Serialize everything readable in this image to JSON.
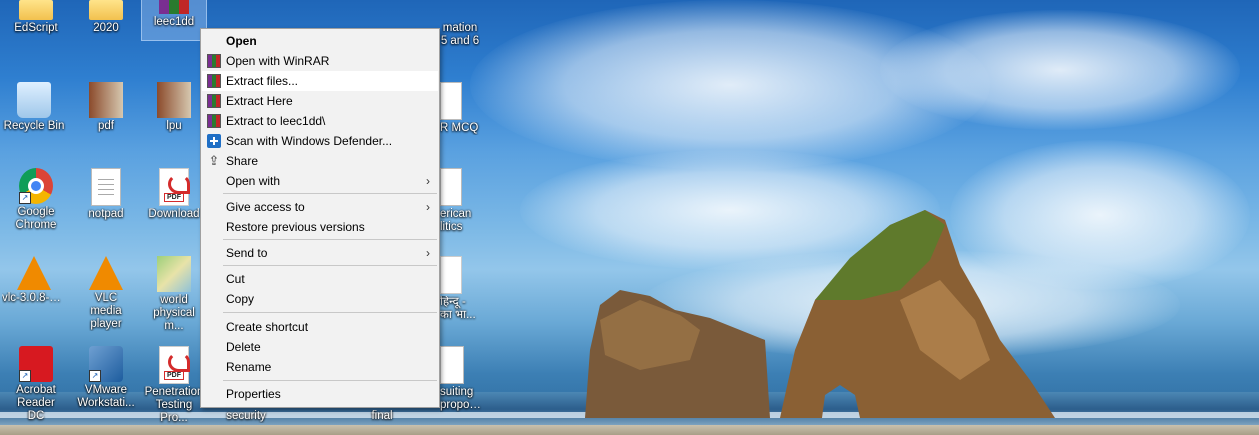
{
  "desktop": {
    "icons": [
      {
        "label": "EdScript",
        "kind": "folder"
      },
      {
        "label": "2020",
        "kind": "folder"
      },
      {
        "label": "leec1dd",
        "kind": "winrar-archive"
      },
      {
        "label": "Recycle Bin",
        "kind": "recycle-bin"
      },
      {
        "label": "pdf",
        "kind": "folder"
      },
      {
        "label": "lpu",
        "kind": "folder"
      },
      {
        "label": "Google Chrome",
        "kind": "chrome"
      },
      {
        "label": "notpad",
        "kind": "text-file"
      },
      {
        "label": "Download",
        "kind": "pdf"
      },
      {
        "label": "vlc-3.0.8-w...",
        "kind": "vlc"
      },
      {
        "label": "VLC media player",
        "kind": "vlc"
      },
      {
        "label": "world physical m...",
        "kind": "map"
      },
      {
        "label": "Acrobat Reader DC",
        "kind": "acrobat"
      },
      {
        "label": "VMware Workstati...",
        "kind": "vmware"
      },
      {
        "label": "Penetration Testing Pro...",
        "kind": "pdf"
      },
      {
        "label": "security",
        "kind": "file"
      },
      {
        "label": "final",
        "kind": "file"
      },
      {
        "label": "mation 5 and 6",
        "kind": "file"
      },
      {
        "label": "R MCQ",
        "kind": "file"
      },
      {
        "label": "erican litics",
        "kind": "file"
      },
      {
        "label": "हिन्दू - का भा...",
        "kind": "pdf"
      },
      {
        "label": "suiting proposal",
        "kind": "ppt"
      }
    ]
  },
  "context_menu": {
    "items": [
      {
        "label": "Open",
        "bold": true,
        "icon": "",
        "submenu": false
      },
      {
        "label": "Open with WinRAR",
        "icon": "winrar-icon",
        "submenu": false
      },
      {
        "label": "Extract files...",
        "icon": "winrar-icon",
        "submenu": false,
        "highlighted": true
      },
      {
        "label": "Extract Here",
        "icon": "winrar-icon",
        "submenu": false
      },
      {
        "label": "Extract to leec1dd\\",
        "icon": "winrar-icon",
        "submenu": false
      },
      {
        "label": "Scan with Windows Defender...",
        "icon": "defender-icon",
        "submenu": false
      },
      {
        "label": "Share",
        "icon": "share-icon",
        "submenu": false
      },
      {
        "label": "Open with",
        "icon": "",
        "submenu": true
      },
      {
        "label": "Give access to",
        "icon": "",
        "submenu": true
      },
      {
        "label": "Restore previous versions",
        "icon": "",
        "submenu": false
      },
      {
        "label": "Send to",
        "icon": "",
        "submenu": true
      },
      {
        "label": "Cut",
        "icon": "",
        "submenu": false
      },
      {
        "label": "Copy",
        "icon": "",
        "submenu": false
      },
      {
        "label": "Create shortcut",
        "icon": "",
        "submenu": false
      },
      {
        "label": "Delete",
        "icon": "",
        "submenu": false
      },
      {
        "label": "Rename",
        "icon": "",
        "submenu": false
      },
      {
        "label": "Properties",
        "icon": "",
        "submenu": false
      }
    ],
    "submenu_arrow": "›",
    "pdf_tag": "PDF"
  }
}
